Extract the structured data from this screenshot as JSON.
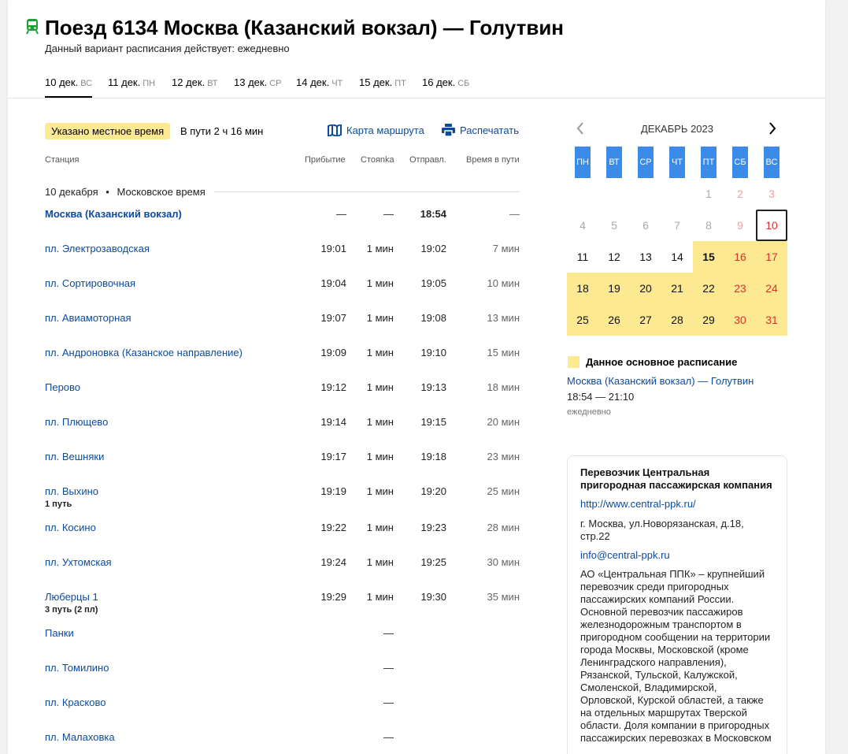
{
  "header": {
    "title": "Поезд 6134 Москва (Казанский вокзал) — Голутвин",
    "subtitle": "Данный вариант расписания действует: ежедневно",
    "icon_color": "#21a038"
  },
  "tabs": [
    {
      "date": "10 дек.",
      "wd": "ВС"
    },
    {
      "date": "11 дек.",
      "wd": "ПН"
    },
    {
      "date": "12 дек.",
      "wd": "ВТ"
    },
    {
      "date": "13 дек.",
      "wd": "СР"
    },
    {
      "date": "14 дек.",
      "wd": "ЧТ"
    },
    {
      "date": "15 дек.",
      "wd": "ПТ"
    },
    {
      "date": "16 дек.",
      "wd": "СБ"
    }
  ],
  "toolbar": {
    "local_time_badge": "Указано местное время",
    "travel_time": "В пути 2 ч 16 мин",
    "route_map": "Карта маршрута",
    "print": "Распечатать"
  },
  "table": {
    "headers": {
      "station": "Станция",
      "arrival": "Прибытие",
      "stop": "Стояnka",
      "departure": "Отправл.",
      "duration": "Время в пути"
    },
    "date_label": "10 декабря",
    "dot": "•",
    "tz_label": "Московское время",
    "rows": [
      {
        "station": "Москва (Казанский вокзал)",
        "arr": "—",
        "stop": "—",
        "dep": "18:54",
        "time": "—"
      },
      {
        "station": "пл. Электрозаводская",
        "arr": "19:01",
        "stop": "1 мин",
        "dep": "19:02",
        "time": "7 мин"
      },
      {
        "station": "пл. Сортировочная",
        "arr": "19:04",
        "stop": "1 мин",
        "dep": "19:05",
        "time": "10 мин"
      },
      {
        "station": "пл. Авиамоторная",
        "arr": "19:07",
        "stop": "1 мин",
        "dep": "19:08",
        "time": "13 мин"
      },
      {
        "station": "пл. Андроновка (Казанское направление)",
        "arr": "19:09",
        "stop": "1 мин",
        "dep": "19:10",
        "time": "15 мин"
      },
      {
        "station": "Перово",
        "arr": "19:12",
        "stop": "1 мин",
        "dep": "19:13",
        "time": "18 мин"
      },
      {
        "station": "пл. Плющево",
        "arr": "19:14",
        "stop": "1 мин",
        "dep": "19:15",
        "time": "20 мин"
      },
      {
        "station": "пл. Вешняки",
        "arr": "19:17",
        "stop": "1 мин",
        "dep": "19:18",
        "time": "23 мин"
      },
      {
        "station": "пл. Выхино",
        "platform": "1 путь",
        "arr": "19:19",
        "stop": "1 мин",
        "dep": "19:20",
        "time": "25 мин"
      },
      {
        "station": "пл. Косино",
        "arr": "19:22",
        "stop": "1 мин",
        "dep": "19:23",
        "time": "28 мин"
      },
      {
        "station": "пл. Ухтомская",
        "arr": "19:24",
        "stop": "1 мин",
        "dep": "19:25",
        "time": "30 мин"
      },
      {
        "station": "Люберцы 1",
        "platform": "3 путь (2 пл)",
        "arr": "19:29",
        "stop": "1 мин",
        "dep": "19:30",
        "time": "35 мин"
      },
      {
        "station": "Панки",
        "stop": "—"
      },
      {
        "station": "пл. Томилино",
        "stop": "—"
      },
      {
        "station": "пл. Красково",
        "stop": "—"
      },
      {
        "station": "пл. Малаховка",
        "stop": "—"
      }
    ]
  },
  "calendar": {
    "month": "ДЕКАБРЬ 2023",
    "weekdays": [
      "ПН",
      "ВТ",
      "СР",
      "ЧТ",
      "ПТ",
      "СБ",
      "ВС"
    ],
    "weekday_color": "#3d8be9",
    "schedule_color": "#fde992",
    "days": [
      [
        "",
        "",
        "",
        "",
        "1",
        "2",
        "3"
      ],
      [
        "4",
        "5",
        "6",
        "7",
        "8",
        "9",
        "10"
      ],
      [
        "11",
        "12",
        "13",
        "14",
        "15",
        "16",
        "17"
      ],
      [
        "18",
        "19",
        "20",
        "21",
        "22",
        "23",
        "24"
      ],
      [
        "25",
        "26",
        "27",
        "28",
        "29",
        "30",
        "31"
      ]
    ]
  },
  "legend": {
    "label": "Данное основное расписание",
    "route": "Москва (Казанский вокзал) — Голутвин",
    "time": "18:54 — 21:10",
    "freq": "ежедневно"
  },
  "carrier": {
    "title": "Перевозчик Центральная пригородная пассажирская компания",
    "url": "http://www.central-ppk.ru/",
    "address": "г. Москва, ул.Новорязанская, д.18, стр.22",
    "email": "info@central-ppk.ru",
    "description": "АО «Центральная ППК» – крупнейший перевозчик среди пригородных пассажирских компаний России. Основной перевозчик пассажиров железнодорожным транспортом в пригородном сообщении на территории города Москвы, Московской (кроме Ленинградского направления), Рязанской, Тульской, Калужской, Смоленской, Владимирской, Орловской, Курской областей, а также на отдельных маршрутах Тверской области. Доля компании в пригородных пассажирских перевозках в Московском"
  }
}
